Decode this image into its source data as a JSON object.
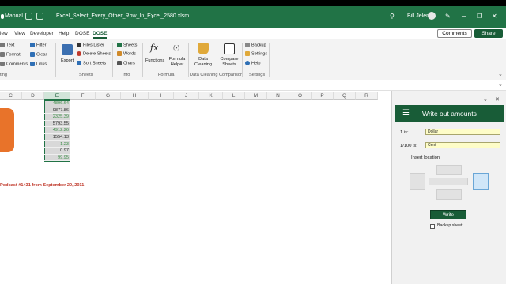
{
  "title_bar": {
    "save_mode": "Manual",
    "filename": "Excel_Select_Every_Other_Row_In_Excel_2580.xlsm",
    "user": "Bill Jelen",
    "minimize": "─",
    "restore": "❐",
    "close": "✕"
  },
  "tabs": [
    "iew",
    "View",
    "Developer",
    "Help",
    "DOSE",
    "DOSE"
  ],
  "active_tab_index": 5,
  "comments_label": "Comments",
  "share_label": "Share",
  "ribbon": {
    "left_items": [
      "Text",
      "Format",
      "Comments"
    ],
    "left_items2": [
      "Filter",
      "Clear",
      "Links"
    ],
    "left_group": "ting",
    "export": "Export",
    "sheets_items": [
      "Files Lister",
      "Delete Sheets",
      "Sort Sheets"
    ],
    "sheets_group": "Sheets",
    "info_items": [
      "Sheets",
      "Words",
      "Chars"
    ],
    "info_group": "Info",
    "functions": "Functions",
    "formula_helper": "Formula Helper",
    "formula_group": "Formula",
    "data_cleaning": "Data Cleaning",
    "data_cleaning_group": "Data Cleaning",
    "compare_sheets": "Compare Sheets",
    "comparison_group": "Comparison",
    "settings_items": [
      "Backup",
      "Settings",
      "Help"
    ],
    "settings_group": "Settings"
  },
  "columns": [
    "C",
    "D",
    "E",
    "F",
    "G",
    "H",
    "I",
    "J",
    "K",
    "L",
    "M",
    "N",
    "O",
    "P",
    "Q",
    "R"
  ],
  "selected_column": "E",
  "cells": [
    {
      "value": "4896.64",
      "tone": "green"
    },
    {
      "value": "9877.86",
      "tone": "grey"
    },
    {
      "value": "2325.39",
      "tone": "green"
    },
    {
      "value": "5793.55",
      "tone": "grey"
    },
    {
      "value": "4912.26",
      "tone": "green"
    },
    {
      "value": "1554.13",
      "tone": "grey"
    },
    {
      "value": "1.23",
      "tone": "green"
    },
    {
      "value": "0.97",
      "tone": "grey"
    },
    {
      "value": "99.95",
      "tone": "green"
    }
  ],
  "podcast_text": "Podcast #1431 from September 20, 2011",
  "pane": {
    "title": "Write out amounts",
    "label1": "1 is:",
    "value1": "Dollar",
    "label2": "1/100 is:",
    "value2": "Cent",
    "insert_location": "Insert location",
    "write_button": "Write",
    "backup_sheet": "Backup sheet"
  },
  "colors": {
    "brand": "#217346",
    "brand_dark": "#185c37",
    "accent_orange": "#e8732a"
  }
}
